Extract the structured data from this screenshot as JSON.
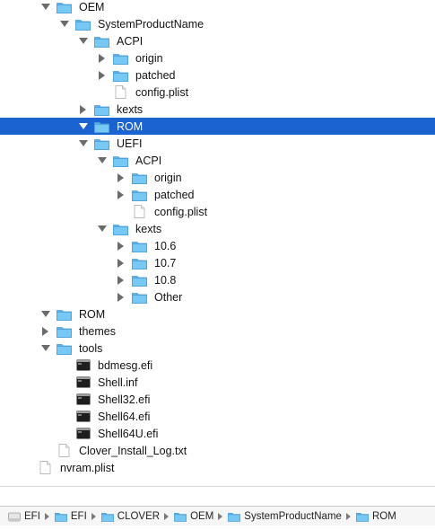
{
  "tree": [
    {
      "label": "OEM",
      "icon": "folder-icon",
      "disclosure": "expanded",
      "level": 0,
      "selected": false
    },
    {
      "label": "SystemProductName",
      "icon": "folder-icon",
      "disclosure": "expanded",
      "level": 1,
      "selected": false
    },
    {
      "label": "ACPI",
      "icon": "folder-icon",
      "disclosure": "expanded",
      "level": 2,
      "selected": false
    },
    {
      "label": "origin",
      "icon": "folder-icon",
      "disclosure": "collapsed",
      "level": 3,
      "selected": false
    },
    {
      "label": "patched",
      "icon": "folder-icon",
      "disclosure": "collapsed",
      "level": 3,
      "selected": false
    },
    {
      "label": "config.plist",
      "icon": "document-icon",
      "disclosure": "none",
      "level": 3,
      "selected": false
    },
    {
      "label": "kexts",
      "icon": "folder-icon",
      "disclosure": "collapsed",
      "level": 2,
      "selected": false
    },
    {
      "label": "ROM",
      "icon": "folder-icon",
      "disclosure": "expanded",
      "level": 2,
      "selected": true
    },
    {
      "label": "UEFI",
      "icon": "folder-icon",
      "disclosure": "expanded",
      "level": 2,
      "selected": false
    },
    {
      "label": "ACPI",
      "icon": "folder-icon",
      "disclosure": "expanded",
      "level": 3,
      "selected": false
    },
    {
      "label": "origin",
      "icon": "folder-icon",
      "disclosure": "collapsed",
      "level": 4,
      "selected": false
    },
    {
      "label": "patched",
      "icon": "folder-icon",
      "disclosure": "collapsed",
      "level": 4,
      "selected": false
    },
    {
      "label": "config.plist",
      "icon": "document-icon",
      "disclosure": "none",
      "level": 4,
      "selected": false
    },
    {
      "label": "kexts",
      "icon": "folder-icon",
      "disclosure": "expanded",
      "level": 3,
      "selected": false
    },
    {
      "label": "10.6",
      "icon": "folder-icon",
      "disclosure": "collapsed",
      "level": 4,
      "selected": false
    },
    {
      "label": "10.7",
      "icon": "folder-icon",
      "disclosure": "collapsed",
      "level": 4,
      "selected": false
    },
    {
      "label": "10.8",
      "icon": "folder-icon",
      "disclosure": "collapsed",
      "level": 4,
      "selected": false
    },
    {
      "label": "Other",
      "icon": "folder-icon",
      "disclosure": "collapsed",
      "level": 4,
      "selected": false
    },
    {
      "label": "ROM",
      "icon": "folder-icon",
      "disclosure": "expanded",
      "level": 0,
      "selected": false
    },
    {
      "label": "themes",
      "icon": "folder-icon",
      "disclosure": "collapsed",
      "level": 0,
      "selected": false
    },
    {
      "label": "tools",
      "icon": "folder-icon",
      "disclosure": "expanded",
      "level": 0,
      "selected": false
    },
    {
      "label": "bdmesg.efi",
      "icon": "terminal-exec-icon",
      "disclosure": "none",
      "level": 1,
      "selected": false
    },
    {
      "label": "Shell.inf",
      "icon": "terminal-exec-icon",
      "disclosure": "none",
      "level": 1,
      "selected": false
    },
    {
      "label": "Shell32.efi",
      "icon": "terminal-exec-icon",
      "disclosure": "none",
      "level": 1,
      "selected": false
    },
    {
      "label": "Shell64.efi",
      "icon": "terminal-exec-icon",
      "disclosure": "none",
      "level": 1,
      "selected": false
    },
    {
      "label": "Shell64U.efi",
      "icon": "terminal-exec-icon",
      "disclosure": "none",
      "level": 1,
      "selected": false
    },
    {
      "label": "Clover_Install_Log.txt",
      "icon": "document-icon",
      "disclosure": "none",
      "level": 0,
      "selected": false
    },
    {
      "label": "nvram.plist",
      "icon": "document-icon",
      "disclosure": "none",
      "level": -1,
      "selected": false
    }
  ],
  "pathbar": [
    {
      "label": "EFI",
      "icon": "drive-icon"
    },
    {
      "label": "EFI",
      "icon": "folder-icon"
    },
    {
      "label": "CLOVER",
      "icon": "folder-icon"
    },
    {
      "label": "OEM",
      "icon": "folder-icon"
    },
    {
      "label": "SystemProductName",
      "icon": "folder-icon"
    },
    {
      "label": "ROM",
      "icon": "folder-icon"
    }
  ],
  "colors": {
    "selection": "#1b63d0",
    "folder": "#6cc0f2",
    "folder_dark": "#4ea7df",
    "disclosure": "#6b6b6b"
  }
}
